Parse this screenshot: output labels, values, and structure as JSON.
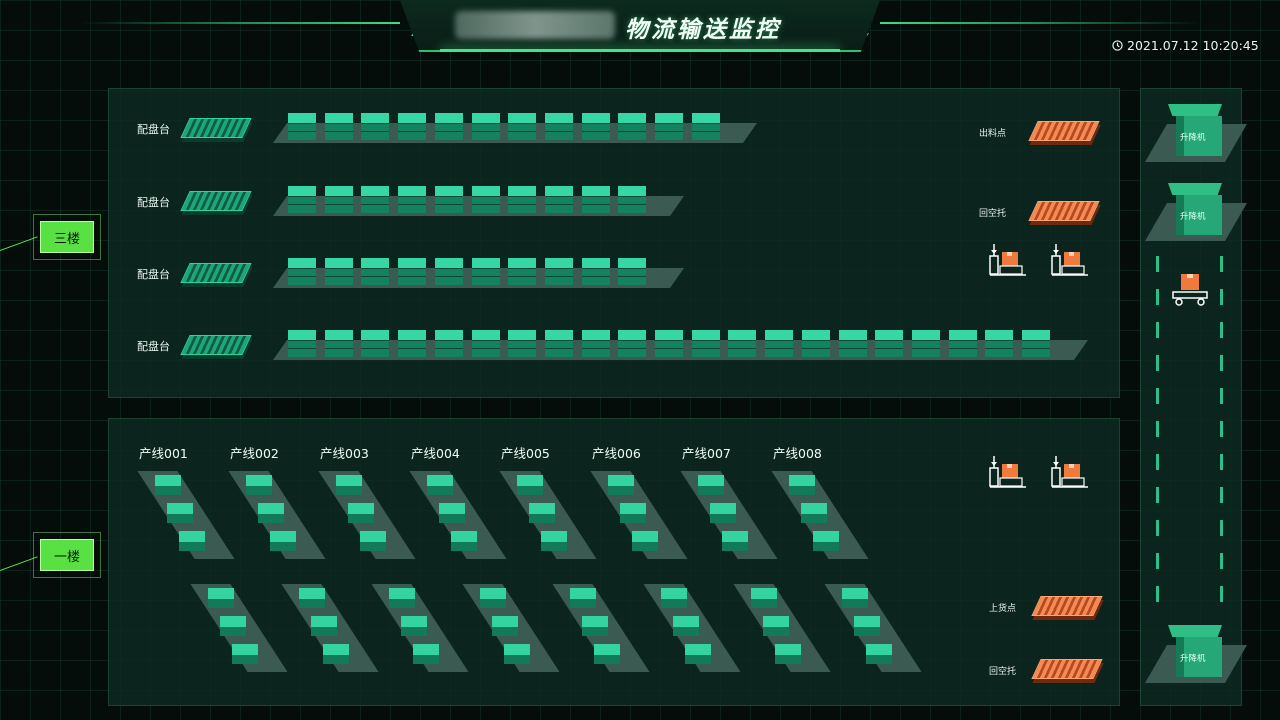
{
  "header": {
    "title": "物流输送监控",
    "datetime": "2021.07.12 10:20:45"
  },
  "icons": {
    "clock": "clock-icon",
    "robot": "palletizer-robot-icon",
    "cart": "transfer-cart-icon"
  },
  "colors": {
    "accent": "#3fdc87",
    "floor_tag": "#59e042",
    "bin": "#1ea67b",
    "pallet_orange": "#f58a52",
    "panel": "#0e2a21"
  },
  "floor3": {
    "tag": "三楼",
    "rows": [
      {
        "label": "配盘台",
        "bins": 12
      },
      {
        "label": "配盘台",
        "bins": 10
      },
      {
        "label": "配盘台",
        "bins": 10
      },
      {
        "label": "配盘台",
        "bins": 21
      }
    ],
    "stations": [
      {
        "label": "出料点"
      },
      {
        "label": "回空托"
      }
    ]
  },
  "floor1": {
    "tag": "一楼",
    "lines": [
      "产线001",
      "产线002",
      "产线003",
      "产线004",
      "产线005",
      "产线006",
      "产线007",
      "产线008"
    ],
    "stations": [
      {
        "label": "上货点"
      },
      {
        "label": "回空托"
      }
    ]
  },
  "lifts": [
    "升降机",
    "升降机",
    "升降机"
  ]
}
